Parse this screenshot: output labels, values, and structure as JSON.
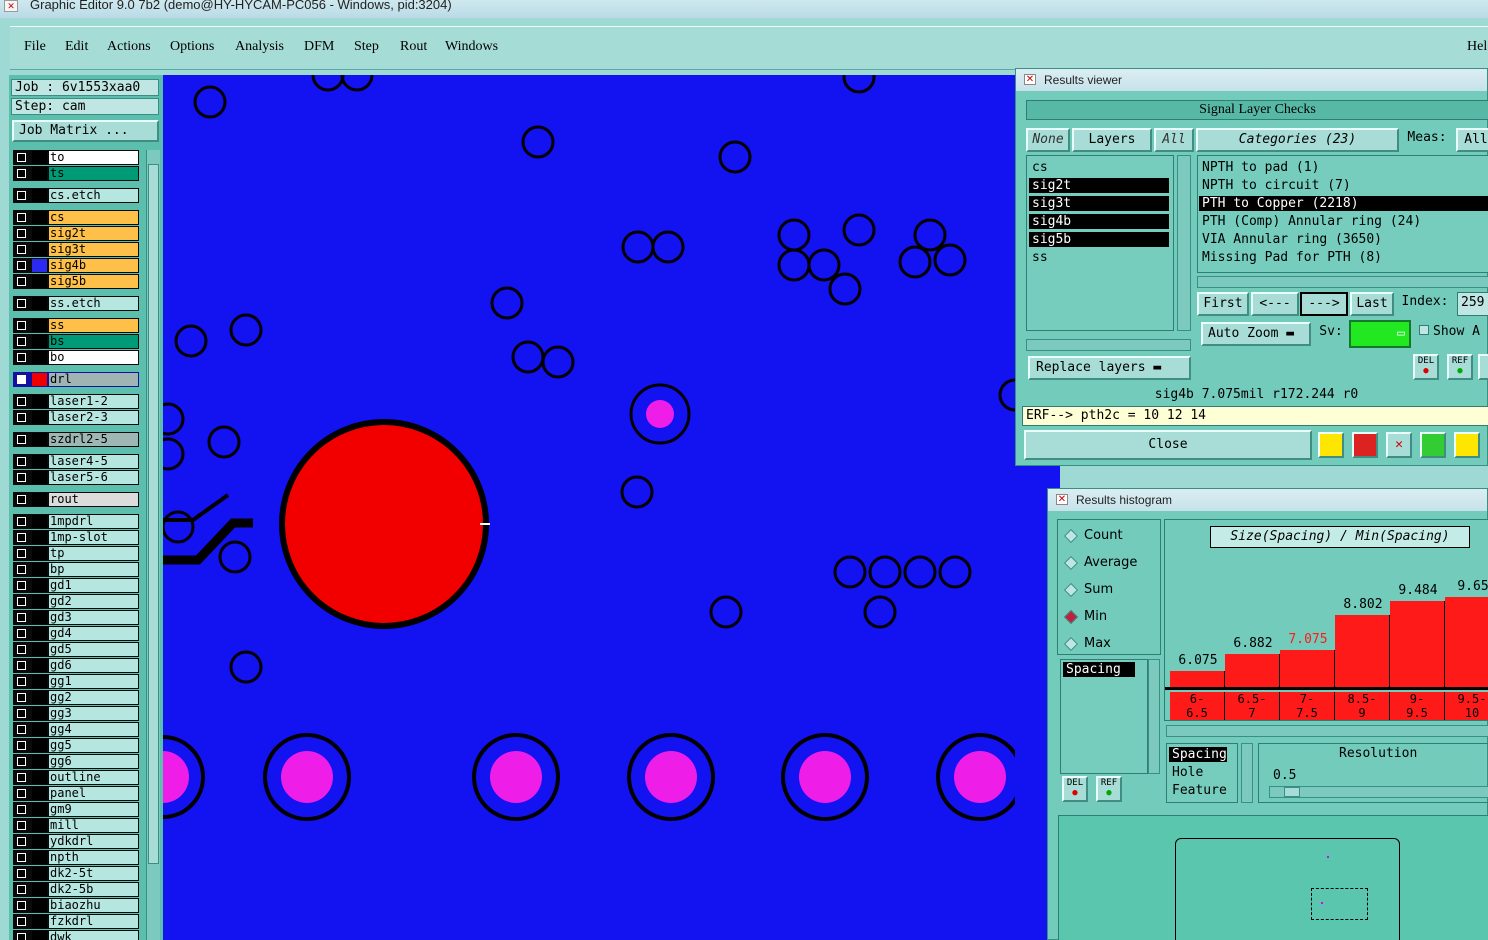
{
  "window": {
    "title": "Graphic Editor 9.0 7b2 (demo@HY-HYCAM-PC056 - Windows, pid:3204)"
  },
  "menu": {
    "items": [
      "File",
      "Edit",
      "Actions",
      "Options",
      "Analysis",
      "DFM",
      "Step",
      "Rout",
      "Windows"
    ],
    "help": "Hel"
  },
  "left_panel": {
    "job": "Job : 6v1553xaa0",
    "step": "Step: cam",
    "job_matrix": "Job Matrix ...",
    "layers": [
      {
        "name": "to",
        "color": "#ffffff"
      },
      {
        "name": "ts",
        "color": "#009a76"
      },
      {
        "name": "cs.etch",
        "color": "#b5e6e0"
      },
      {
        "name": "cs",
        "color": "#ffc04a"
      },
      {
        "name": "sig2t",
        "color": "#ffc04a"
      },
      {
        "name": "sig3t",
        "color": "#ffc04a"
      },
      {
        "name": "sig4b",
        "color": "#ffc04a"
      },
      {
        "name": "sig5b",
        "color": "#ffc04a"
      },
      {
        "name": "ss.etch",
        "color": "#b5e6e0"
      },
      {
        "name": "ss",
        "color": "#ffc04a"
      },
      {
        "name": "bs",
        "color": "#009a76"
      },
      {
        "name": "bo",
        "color": "#ffffff"
      },
      {
        "name": "drl",
        "color": "#a0b4b4"
      },
      {
        "name": "laser1-2",
        "color": "#b5e6e0"
      },
      {
        "name": "laser2-3",
        "color": "#b5e6e0"
      },
      {
        "name": "szdrl2-5",
        "color": "#9fb7b4"
      },
      {
        "name": "laser4-5",
        "color": "#b5e6e0"
      },
      {
        "name": "laser5-6",
        "color": "#b5e6e0"
      },
      {
        "name": "rout",
        "color": "#dcdcdc"
      },
      {
        "name": "1mpdrl",
        "color": "#b5e6e0"
      },
      {
        "name": "1mp-slot",
        "color": "#b5e6e0"
      },
      {
        "name": "tp",
        "color": "#b5e6e0"
      },
      {
        "name": "bp",
        "color": "#b5e6e0"
      },
      {
        "name": "gd1",
        "color": "#b5e6e0"
      },
      {
        "name": "gd2",
        "color": "#b5e6e0"
      },
      {
        "name": "gd3",
        "color": "#b5e6e0"
      },
      {
        "name": "gd4",
        "color": "#b5e6e0"
      },
      {
        "name": "gd5",
        "color": "#b5e6e0"
      },
      {
        "name": "gd6",
        "color": "#b5e6e0"
      },
      {
        "name": "gg1",
        "color": "#b5e6e0"
      },
      {
        "name": "gg2",
        "color": "#b5e6e0"
      },
      {
        "name": "gg3",
        "color": "#b5e6e0"
      },
      {
        "name": "gg4",
        "color": "#b5e6e0"
      },
      {
        "name": "gg5",
        "color": "#b5e6e0"
      },
      {
        "name": "gg6",
        "color": "#b5e6e0"
      },
      {
        "name": "outline",
        "color": "#b5e6e0"
      },
      {
        "name": "panel",
        "color": "#b5e6e0"
      },
      {
        "name": "gm9",
        "color": "#b5e6e0"
      },
      {
        "name": "mill",
        "color": "#b5e6e0"
      },
      {
        "name": "ydkdrl",
        "color": "#b5e6e0"
      },
      {
        "name": "npth",
        "color": "#b5e6e0"
      },
      {
        "name": "dk2-5t",
        "color": "#b5e6e0"
      },
      {
        "name": "dk2-5b",
        "color": "#b5e6e0"
      },
      {
        "name": "biaozhu",
        "color": "#b5e6e0"
      },
      {
        "name": "fzkdrl",
        "color": "#b5e6e0"
      },
      {
        "name": "dwk",
        "color": "#b5e6e0"
      }
    ]
  },
  "results_viewer": {
    "title": "Results viewer",
    "header": "Signal Layer Checks",
    "none": "None",
    "layers_tab": "Layers",
    "all": "All",
    "categories_tab": "Categories (23)",
    "meas": "Meas:",
    "meas_all": "All",
    "layers": [
      {
        "name": "cs",
        "selected": false
      },
      {
        "name": "sig2t",
        "selected": true
      },
      {
        "name": "sig3t",
        "selected": true
      },
      {
        "name": "sig4b",
        "selected": true
      },
      {
        "name": "sig5b",
        "selected": true
      },
      {
        "name": "ss",
        "selected": false
      }
    ],
    "categories": [
      {
        "name": "NPTH to pad (1)",
        "selected": false
      },
      {
        "name": "NPTH to circuit (7)",
        "selected": false
      },
      {
        "name": "PTH to Copper (2218)",
        "selected": true
      },
      {
        "name": "PTH (Comp) Annular ring (24)",
        "selected": false
      },
      {
        "name": "VIA Annular ring (3650)",
        "selected": false
      },
      {
        "name": "Missing Pad for PTH (8)",
        "selected": false
      }
    ],
    "first": "First",
    "prev": "<---",
    "next": "--->",
    "last": "Last",
    "index_label": "Index:",
    "index_value": "259",
    "auto_zoom": "Auto Zoom",
    "sv": "Sv:",
    "show": "Show A",
    "replace_layers": "Replace layers",
    "status": "sig4b 7.075mil  r172.244  r0",
    "erf": "ERF--> pth2c = 10 12 14",
    "close": "Close",
    "del": "DEL",
    "ref": "REF"
  },
  "histogram": {
    "title": "Results histogram",
    "modes": [
      {
        "name": "Count",
        "on": false
      },
      {
        "name": "Average",
        "on": false
      },
      {
        "name": "Sum",
        "on": false
      },
      {
        "name": "Min",
        "on": true
      },
      {
        "name": "Max",
        "on": false
      }
    ],
    "type_list": [
      "Spacing"
    ],
    "chart_title": "Size(Spacing) / Min(Spacing)",
    "chart_data": {
      "type": "bar",
      "title": "Size(Spacing) / Min(Spacing)",
      "categories": [
        "6-6.5",
        "6.5-7",
        "7-7.5",
        "8.5-9",
        "9-9.5",
        "9.5-10"
      ],
      "values": [
        6.075,
        6.882,
        7.075,
        8.802,
        9.484,
        9.65
      ],
      "value_labels": [
        "6.075",
        "6.882",
        "7.075",
        "8.802",
        "9.484",
        "9.65"
      ],
      "bin_top": [
        "6-",
        "6.5-",
        "7-",
        "8.5-",
        "9-",
        "9.5-"
      ],
      "bin_bottom": [
        "6.5",
        "7",
        "7.5",
        "9",
        "9.5",
        "10"
      ],
      "highlight_index": 2
    },
    "group_by": [
      "Spacing",
      "Hole",
      "Feature"
    ],
    "resolution_label": "Resolution",
    "resolution_value": "0.5",
    "del": "DEL",
    "ref": "REF"
  }
}
